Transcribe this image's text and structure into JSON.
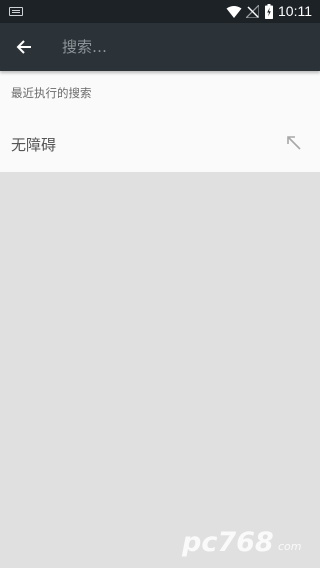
{
  "status_bar": {
    "time": "10:11",
    "icons": [
      "keyboard-icon",
      "wifi-icon",
      "signal-off-icon",
      "battery-charging-icon"
    ]
  },
  "toolbar": {
    "back_icon": "arrow-back-icon",
    "search_placeholder": "搜索…"
  },
  "recent_searches": {
    "header": "最近执行的搜索",
    "items": [
      {
        "label": "无障碍",
        "action_icon": "arrow-up-left-icon"
      }
    ]
  },
  "watermark": {
    "text": "pc768",
    "subtext": "com"
  },
  "colors": {
    "status_bar": "#1d2226",
    "toolbar": "#2c3338",
    "panel": "#fafafa",
    "background": "#e0e0e0"
  }
}
